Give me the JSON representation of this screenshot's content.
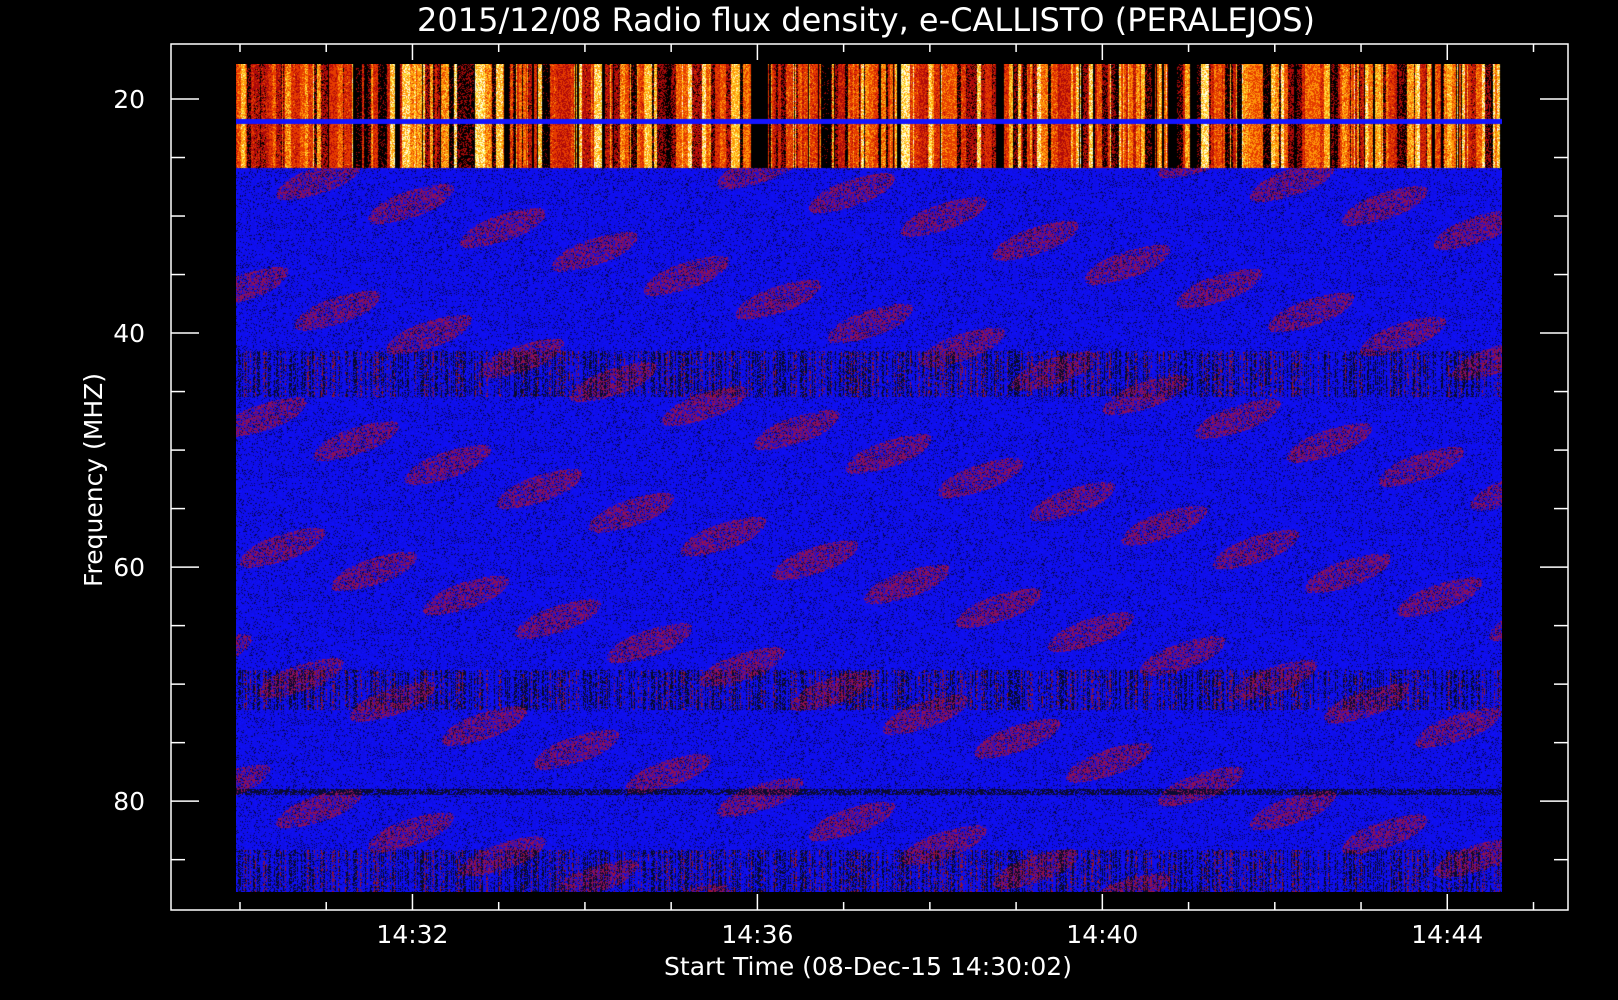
{
  "chart_data": {
    "type": "heatmap",
    "title": "2015/12/08  Radio flux density, e-CALLISTO (PERALEJOS)",
    "xlabel": "Start Time (08-Dec-15 14:30:02)",
    "ylabel": "Frequency (MHZ)",
    "x_ticks": [
      "14:32",
      "14:36",
      "14:40",
      "14:44"
    ],
    "x_tick_minutes": [
      2,
      6,
      10,
      14
    ],
    "y_ticks": [
      "20",
      "40",
      "60",
      "80"
    ],
    "y_tick_values": [
      20,
      40,
      60,
      80
    ],
    "xlim_minutes": [
      -0.8,
      15.4
    ],
    "ylim_mhz": [
      15.3,
      89.3
    ],
    "data_time_range_minutes": [
      0,
      15
    ],
    "data_freq_range_mhz": [
      17.3,
      88.7
    ],
    "colormap": [
      "#000000",
      "#1414ff",
      "#2a2aff",
      "#7a1414",
      "#d43200",
      "#ff8a00",
      "#ffe840",
      "#ffffff"
    ],
    "bands": [
      {
        "name": "bright burst band",
        "freq_mhz": [
          17.3,
          26.2
        ],
        "intensity": "high"
      },
      {
        "name": "separator line",
        "freq_mhz": [
          22.0,
          22.4
        ],
        "intensity": "low"
      },
      {
        "name": "dark streaks",
        "freq_mhz": [
          42.0,
          46.0
        ],
        "intensity": "mixed"
      },
      {
        "name": "dark streaks",
        "freq_mhz": [
          69.5,
          73.0
        ],
        "intensity": "mixed"
      },
      {
        "name": "dark line",
        "freq_mhz": [
          79.8,
          80.3
        ],
        "intensity": "low"
      },
      {
        "name": "noisy bottom band",
        "freq_mhz": [
          85.0,
          88.7
        ],
        "intensity": "mixed"
      }
    ]
  }
}
